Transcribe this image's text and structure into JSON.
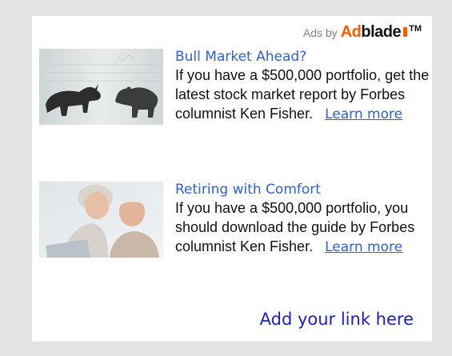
{
  "brand": {
    "ads_by": "Ads by",
    "logo_part1": "Ad",
    "logo_part2": "blade",
    "trademark": "TM"
  },
  "ads": [
    {
      "title": "Bull Market Ahead?",
      "body": "If you have a $500,000 portfolio, get the latest stock market report by Forbes columnist Ken Fisher.",
      "link_label": "Learn more",
      "image": "bull-and-bear-figurines"
    },
    {
      "title": "Retiring with Comfort",
      "body": "If you have a $500,000 portfolio, you should download the guide by Forbes columnist Ken Fisher.",
      "link_label": "Learn more",
      "image": "senior-couple-laptop"
    }
  ],
  "footer": {
    "add_link_label": "Add your link here"
  },
  "colors": {
    "frame": "#e3e3e3",
    "link": "#2b5fe0",
    "footer_link": "#1a1adb",
    "brand_orange": "#ff5a00"
  }
}
